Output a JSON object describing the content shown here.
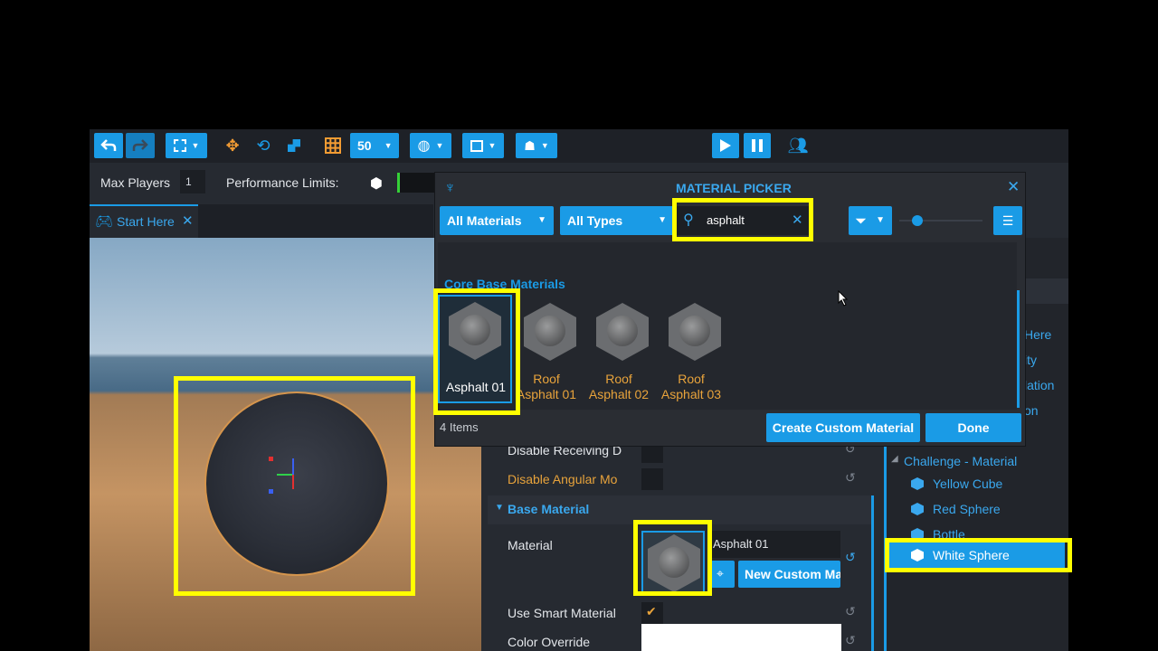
{
  "toolbar": {
    "snap_value": "50"
  },
  "perf_bar": {
    "max_players_label": "Max Players",
    "max_players_value": "1",
    "performance_label": "Performance Limits:"
  },
  "tab": {
    "label": "Start Here"
  },
  "dialog": {
    "title": "MATERIAL PICKER",
    "filter_all_materials": "All Materials",
    "filter_all_types": "All Types",
    "search_value": "asphalt",
    "section_label": "Core Base Materials",
    "items": [
      {
        "label_line1": "Asphalt 01",
        "label_line2": ""
      },
      {
        "label_line1": "Roof",
        "label_line2": "Asphalt 01"
      },
      {
        "label_line1": "Roof",
        "label_line2": "Asphalt 02"
      },
      {
        "label_line1": "Roof",
        "label_line2": "Asphalt 03"
      }
    ],
    "count": "4 Items",
    "create_button": "Create Custom Material",
    "done_button": "Done"
  },
  "properties": {
    "disable_receiving": "Disable Receiving D",
    "disable_angular": "Disable Angular Mo",
    "section_base_material": "Base Material",
    "material_label": "Material",
    "material_value": "Asphalt 01",
    "new_custom_button": "New Custom Ma",
    "smart_material": "Use Smart Material",
    "color_override": "Color Override"
  },
  "hierarchy": {
    "partial": [
      "Here",
      "ity",
      "lation",
      "on"
    ],
    "folder": "Challenge - Material",
    "items": [
      "Yellow Cube",
      "Red Sphere",
      "Bottle",
      "White Sphere"
    ]
  },
  "colors": {
    "accent": "#1a9be6",
    "highlight": "#ffff00",
    "orange": "#e8a33b"
  }
}
